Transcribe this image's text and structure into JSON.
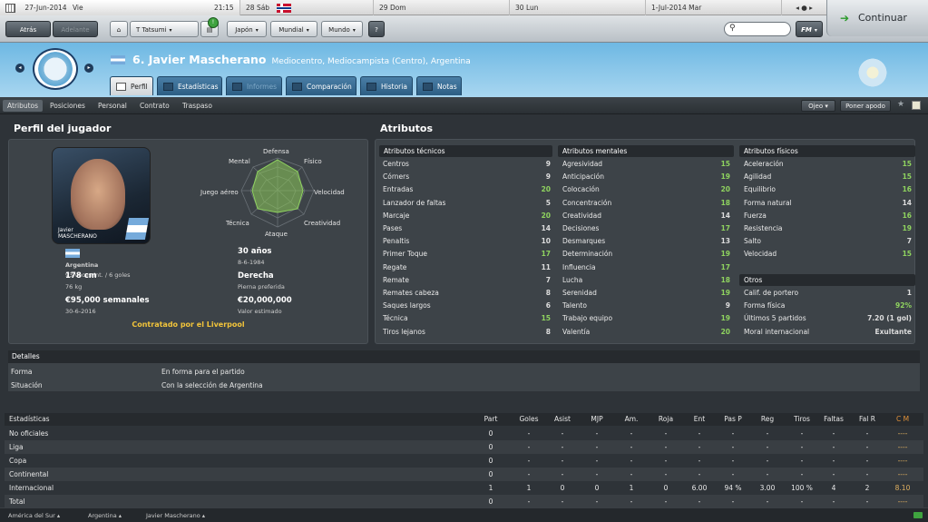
{
  "calendar": {
    "current_date": "27-Jun-2014",
    "current_day": "Vie",
    "time": "21:15",
    "days": [
      {
        "date": "28",
        "day": "Sáb"
      },
      {
        "date": "29",
        "day": "Dom"
      },
      {
        "date": "30",
        "day": "Lun"
      },
      {
        "date": "1-Jul-2014",
        "day": "Mar"
      }
    ]
  },
  "toolbar": {
    "back": "Atrás",
    "forward": "Adelante",
    "manager": "T Tatsumi",
    "menu_japan": "Japón",
    "menu_world_cup": "Mundial",
    "menu_world": "Mundo",
    "help": "?",
    "fm_menu": "FM",
    "continue": "Continuar"
  },
  "player": {
    "number_name": "6. Javier Mascherano",
    "subtitle": "Mediocentro, Mediocampista (Centro), Argentina"
  },
  "tabs": [
    {
      "label": "Perfil",
      "active": true
    },
    {
      "label": "Estadísticas",
      "active": false
    },
    {
      "label": "Informes",
      "active": false,
      "disabled": true
    },
    {
      "label": "Comparación",
      "active": false
    },
    {
      "label": "Historia",
      "active": false
    },
    {
      "label": "Notas",
      "active": false
    }
  ],
  "subnav": {
    "items": [
      "Atributos",
      "Posiciones",
      "Personal",
      "Contrato",
      "Traspaso"
    ],
    "scout_btn": "Ojeo",
    "support_btn": "Poner apodo"
  },
  "profile": {
    "heading": "Perfil del jugador",
    "photo_first": "Javier",
    "photo_last": "MASCHERANO",
    "radar_labels": {
      "top": "Defensa",
      "top_left": "Mental",
      "top_right": "Físico",
      "left": "Juego aéreo",
      "right": "Velocidad",
      "bottom_left": "Técnica",
      "bottom_right": "Creatividad",
      "bottom": "Ataque"
    },
    "nation": "Argentina",
    "caps": "93 veces int. / 6 goles",
    "age": "30 años",
    "dob": "8-6-1984",
    "height": "178 cm",
    "weight": "76 kg",
    "foot": "Derecha",
    "foot_label": "Pierna preferida",
    "wage": "€95,000 semanales",
    "contract_end": "30-6-2016",
    "value": "€20,000,000",
    "value_label": "Valor estimado",
    "contract_note": "Contratado por el Liverpool"
  },
  "attributes": {
    "heading": "Atributos",
    "technical_title": "Atributos técnicos",
    "mental_title": "Atributos mentales",
    "physical_title": "Atributos físicos",
    "others_title": "Otros",
    "technical": [
      {
        "name": "Centros",
        "value": "9"
      },
      {
        "name": "Córners",
        "value": "9"
      },
      {
        "name": "Entradas",
        "value": "20"
      },
      {
        "name": "Lanzador de faltas",
        "value": "5"
      },
      {
        "name": "Marcaje",
        "value": "20"
      },
      {
        "name": "Pases",
        "value": "14"
      },
      {
        "name": "Penaltis",
        "value": "10"
      },
      {
        "name": "Primer Toque",
        "value": "17"
      },
      {
        "name": "Regate",
        "value": "11"
      },
      {
        "name": "Remate",
        "value": "7"
      },
      {
        "name": "Remates cabeza",
        "value": "8"
      },
      {
        "name": "Saques largos",
        "value": "6"
      },
      {
        "name": "Técnica",
        "value": "15"
      },
      {
        "name": "Tiros lejanos",
        "value": "8"
      }
    ],
    "mental": [
      {
        "name": "Agresividad",
        "value": "15"
      },
      {
        "name": "Anticipación",
        "value": "19"
      },
      {
        "name": "Colocación",
        "value": "20"
      },
      {
        "name": "Concentración",
        "value": "18"
      },
      {
        "name": "Creatividad",
        "value": "14"
      },
      {
        "name": "Decisiones",
        "value": "17"
      },
      {
        "name": "Desmarques",
        "value": "13"
      },
      {
        "name": "Determinación",
        "value": "19"
      },
      {
        "name": "Influencia",
        "value": "17"
      },
      {
        "name": "Lucha",
        "value": "18"
      },
      {
        "name": "Serenidad",
        "value": "19"
      },
      {
        "name": "Talento",
        "value": "9"
      },
      {
        "name": "Trabajo equipo",
        "value": "19"
      },
      {
        "name": "Valentía",
        "value": "20"
      }
    ],
    "physical": [
      {
        "name": "Aceleración",
        "value": "15"
      },
      {
        "name": "Agilidad",
        "value": "15"
      },
      {
        "name": "Equilibrio",
        "value": "16"
      },
      {
        "name": "Forma natural",
        "value": "14"
      },
      {
        "name": "Fuerza",
        "value": "16"
      },
      {
        "name": "Resistencia",
        "value": "19"
      },
      {
        "name": "Salto",
        "value": "7"
      },
      {
        "name": "Velocidad",
        "value": "15"
      }
    ],
    "others": [
      {
        "name": "Calif. de portero",
        "value": "1"
      },
      {
        "name": "Forma física",
        "value": "92%"
      },
      {
        "name": "Últimos 5 partidos",
        "value": "7.20 (1 gol)"
      },
      {
        "name": "Moral internacional",
        "value": "Exultante"
      }
    ]
  },
  "details": {
    "heading": "Detalles",
    "rows": [
      {
        "label": "Forma",
        "value": "En forma para el partido"
      },
      {
        "label": "Situación",
        "value": "Con la selección de Argentina"
      }
    ]
  },
  "stats": {
    "headers": [
      "Estadísticas",
      "Part",
      "Goles",
      "Asist",
      "MJP",
      "Am.",
      "Roja",
      "Ent",
      "Pas P",
      "Reg",
      "Tiros",
      "Faltas",
      "Fal R",
      "C M"
    ],
    "rows": [
      [
        "No oficiales",
        "0",
        "-",
        "-",
        "-",
        "-",
        "-",
        "-",
        "-",
        "-",
        "-",
        "-",
        "-",
        "----"
      ],
      [
        "Liga",
        "0",
        "-",
        "-",
        "-",
        "-",
        "-",
        "-",
        "-",
        "-",
        "-",
        "-",
        "-",
        "----"
      ],
      [
        "Copa",
        "0",
        "-",
        "-",
        "-",
        "-",
        "-",
        "-",
        "-",
        "-",
        "-",
        "-",
        "-",
        "----"
      ],
      [
        "Continental",
        "0",
        "-",
        "-",
        "-",
        "-",
        "-",
        "-",
        "-",
        "-",
        "-",
        "-",
        "-",
        "----"
      ],
      [
        "Internacional",
        "1",
        "1",
        "0",
        "0",
        "1",
        "0",
        "6.00",
        "94 %",
        "3.00",
        "100 %",
        "4",
        "2",
        "8.10"
      ],
      [
        "Total",
        "0",
        "-",
        "-",
        "-",
        "-",
        "-",
        "-",
        "-",
        "-",
        "-",
        "-",
        "-",
        "----"
      ]
    ]
  },
  "breadcrumb": [
    "América del Sur",
    "Argentina",
    "Javier Mascherano"
  ],
  "colors": {
    "accent_header": "#6eb8e3",
    "good_value": "#8fd35f",
    "contract_note": "#f2c43a",
    "cm_header": "#e0913a"
  }
}
